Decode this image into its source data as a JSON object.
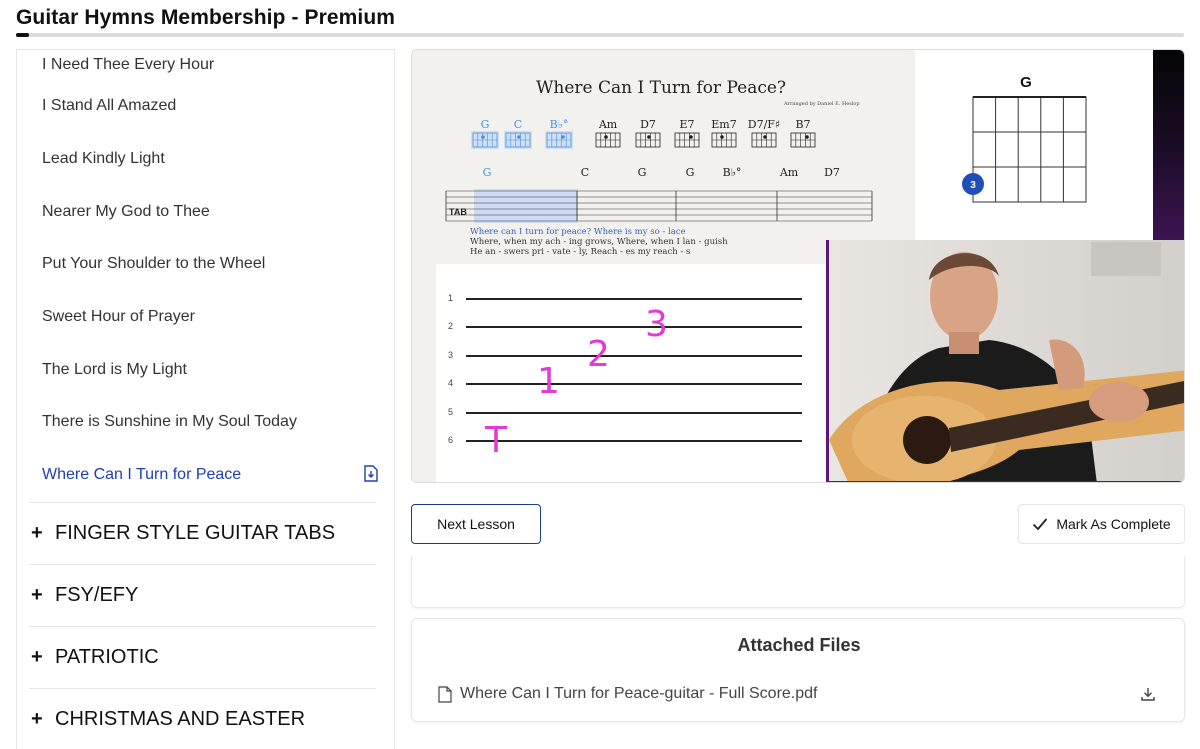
{
  "header": {
    "title": "Guitar Hymns Membership - Premium",
    "progress": 0.011
  },
  "sidebar": {
    "lessons": [
      {
        "label": "I Need Thee Every Hour"
      },
      {
        "label": "I Stand All Amazed"
      },
      {
        "label": "Lead Kindly Light"
      },
      {
        "label": "Nearer My God to Thee"
      },
      {
        "label": "Put Your Shoulder to the Wheel"
      },
      {
        "label": "Sweet Hour of Prayer"
      },
      {
        "label": "The Lord is My Light"
      },
      {
        "label": "There is Sunshine in My Soul Today"
      },
      {
        "label": "Where Can I Turn for Peace",
        "active": true
      }
    ],
    "sections": [
      {
        "label": "FINGER STYLE GUITAR TABS"
      },
      {
        "label": "FSY/EFY"
      },
      {
        "label": "PATRIOTIC"
      },
      {
        "label": "CHRISTMAS AND EASTER"
      }
    ],
    "active_color": "#1e40af"
  },
  "video": {
    "sheet_title": "Where Can I Turn for Peace?",
    "arranger": "Arranged by Daniel E. Heslop",
    "chord_diagrams": [
      "G",
      "C",
      "B♭°",
      "Am",
      "D7",
      "E7",
      "Em7",
      "D7/F♯",
      "B7"
    ],
    "staff_chords": [
      "G",
      "C",
      "G",
      "G",
      "B♭°",
      "Am",
      "D7"
    ],
    "lyrics_line1": "Where  can  I  turn  for  peace?  Where  is  my  so - lace",
    "lyrics_line2": "Where,  when  my  ach - ing  grows,  Where,  when  I  lan - guish",
    "lyrics_line3": "He  an - swers  pri - vate - ly,  Reach - es  my  reach - s",
    "tab_string_numbers": [
      "1",
      "2",
      "3",
      "4",
      "5",
      "6"
    ],
    "finger_labels": [
      "T",
      "1",
      "2",
      "3"
    ],
    "chord_box_name": "G",
    "chord_box_finger": "3",
    "accent_blue": "#4a90d9",
    "pink": "#e13ad6"
  },
  "actions": {
    "next_label": "Next Lesson",
    "complete_label": "Mark As Complete"
  },
  "files": {
    "title": "Attached Files",
    "items": [
      {
        "name": "Where Can I Turn for Peace-guitar - Full Score.pdf"
      }
    ]
  }
}
